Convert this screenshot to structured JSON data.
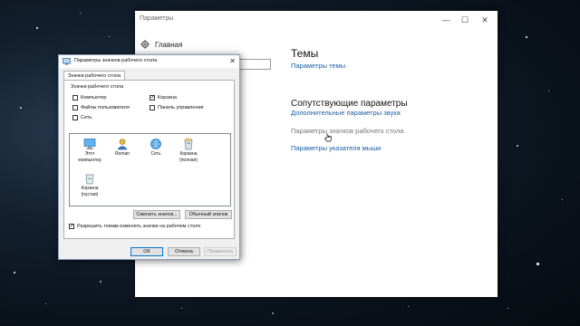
{
  "settings_window": {
    "title": "Параметры",
    "sidebar": {
      "home_label": "Главная",
      "search_placeholder": ""
    },
    "themes_heading": "Темы",
    "themes_link": "Параметры темы",
    "related_heading": "Сопутствующие параметры",
    "related_links": [
      "Дополнительные параметры звука",
      "Параметры значков рабочего стола",
      "Параметры указателя мыши"
    ]
  },
  "dialog": {
    "title": "Параметры значков рабочего стола",
    "tab_label": "Значки рабочего стола",
    "group_label": "Значки рабочего стола",
    "checkboxes": [
      {
        "label": "Компьютер",
        "checked": false
      },
      {
        "label": "Корзина",
        "checked": true
      },
      {
        "label": "Файлы пользователя",
        "checked": false
      },
      {
        "label": "Панель управления",
        "checked": false
      },
      {
        "label": "Сеть",
        "checked": false
      }
    ],
    "icons": [
      {
        "line1": "Этот",
        "line2": "компьютер"
      },
      {
        "line1": "Roman",
        "line2": ""
      },
      {
        "line1": "Сеть",
        "line2": ""
      },
      {
        "line1": "Корзина",
        "line2": "(полная)"
      },
      {
        "line1": "Корзина",
        "line2": "(пустая)"
      }
    ],
    "change_icon_button": "Сменить значок...",
    "default_icon_button": "Обычный значок",
    "allow_themes_label": "Разрешить темам изменять значки на рабочем столе",
    "allow_themes_checked": true,
    "ok_button": "ОК",
    "cancel_button": "Отмена",
    "apply_button": "Применить"
  }
}
